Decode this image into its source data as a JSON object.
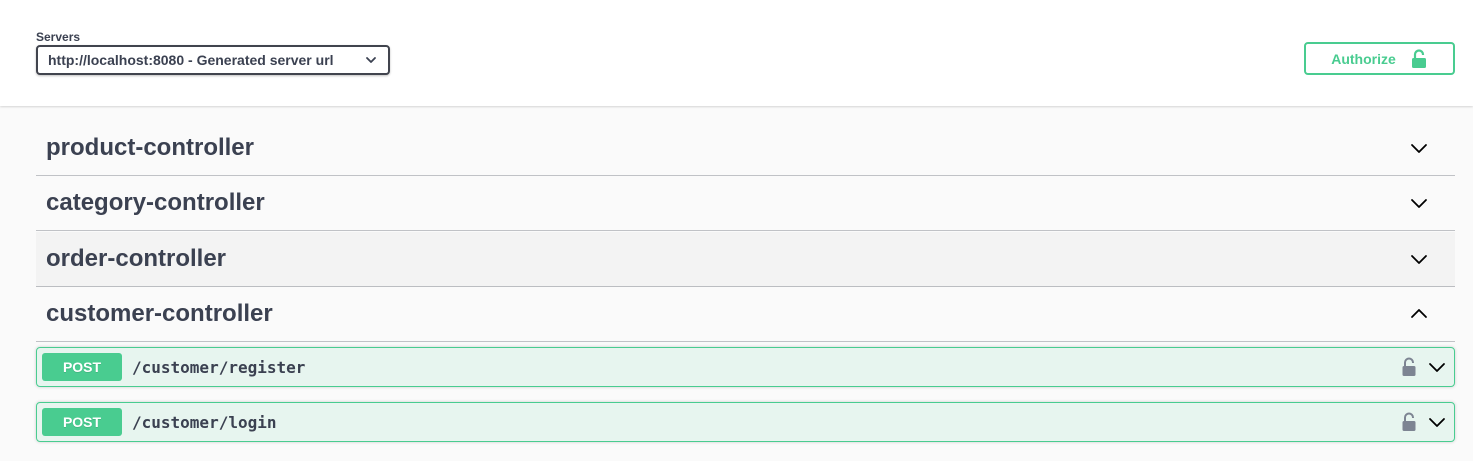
{
  "servers": {
    "label": "Servers",
    "selected": "http://localhost:8080 - Generated server url"
  },
  "authorize": {
    "label": "Authorize"
  },
  "tags": [
    {
      "name": "product-controller",
      "expanded": false
    },
    {
      "name": "category-controller",
      "expanded": false
    },
    {
      "name": "order-controller",
      "expanded": false
    },
    {
      "name": "customer-controller",
      "expanded": true
    }
  ],
  "operations": [
    {
      "method": "POST",
      "path": "/customer/register"
    },
    {
      "method": "POST",
      "path": "/customer/login"
    }
  ],
  "colors": {
    "post": "#49cc90",
    "text": "#3b4151",
    "lock": "#7d8492"
  },
  "icons": {
    "authorize": "unlocked-icon",
    "operation_lock": "unlocked-icon",
    "collapsed": "chevron-down-icon",
    "expanded": "chevron-up-icon"
  }
}
